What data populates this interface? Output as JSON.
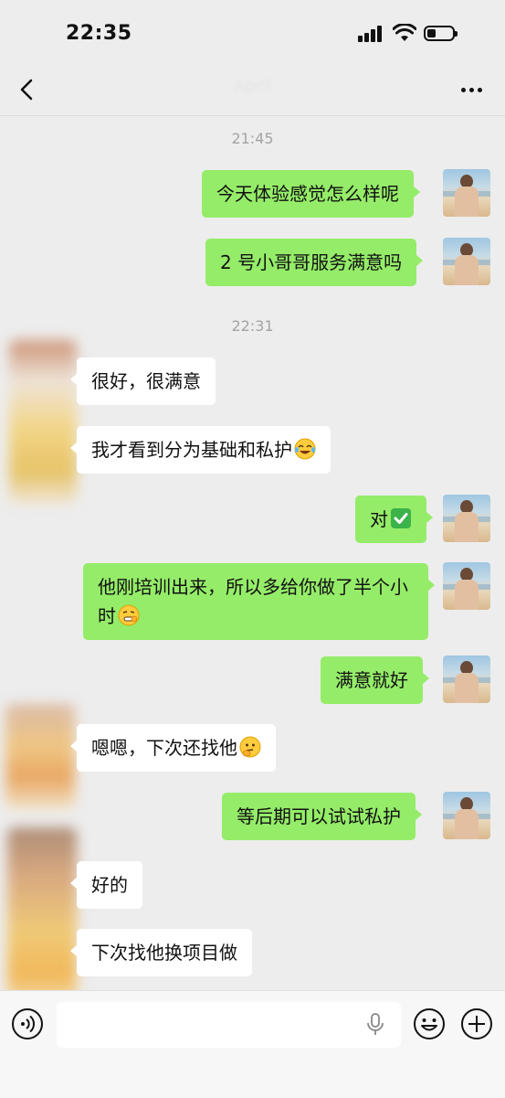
{
  "status_bar": {
    "time": "22:35"
  },
  "header": {
    "title": "April"
  },
  "input": {
    "placeholder": ""
  },
  "timestamps": [
    "21:45",
    "22:31"
  ],
  "messages": [
    {
      "side": "out",
      "text": "今天体验感觉怎么样呢"
    },
    {
      "side": "out",
      "text": "2 号小哥哥服务满意吗"
    },
    {
      "side": "in",
      "text": "很好，很满意"
    },
    {
      "side": "in",
      "text": "我才看到分为基础和私护",
      "emoji": "laugh-tears-emoji"
    },
    {
      "side": "out",
      "text": "对",
      "emoji": "check-mark-emoji"
    },
    {
      "side": "out",
      "text": "他刚培训出来，所以多给你做了半个小时",
      "emoji": "grimace-emoji"
    },
    {
      "side": "out",
      "text": "满意就好"
    },
    {
      "side": "in",
      "text": "嗯嗯，下次还找他",
      "emoji": "thinking-emoji"
    },
    {
      "side": "out",
      "text": "等后期可以试试私护"
    },
    {
      "side": "in",
      "text": "好的"
    },
    {
      "side": "in",
      "text": "下次找他换项目做"
    }
  ],
  "colors": {
    "outgoing_bubble": "#95ec69",
    "incoming_bubble": "#ffffff",
    "background": "#ededed"
  }
}
